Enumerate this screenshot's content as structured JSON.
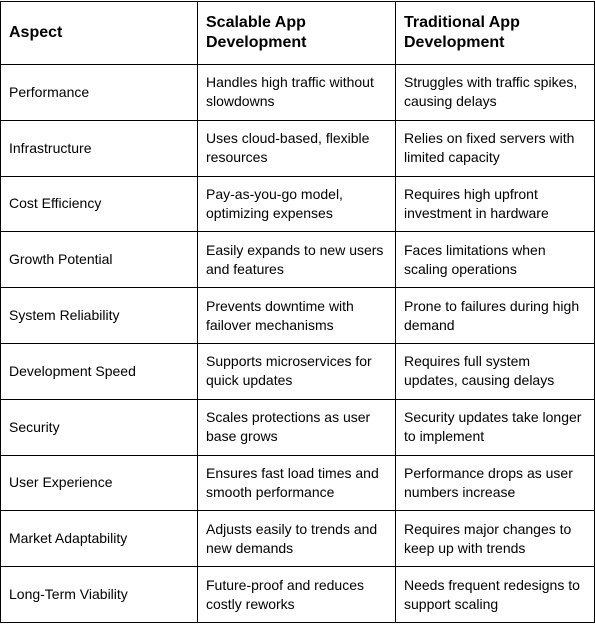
{
  "table": {
    "headers": [
      "Aspect",
      "Scalable App Development",
      "Traditional App Development"
    ],
    "rows": [
      [
        "Performance",
        "Handles high traffic without slowdowns",
        "Struggles with traffic spikes, causing delays"
      ],
      [
        "Infrastructure",
        "Uses cloud-based, flexible resources",
        "Relies on fixed servers with limited capacity"
      ],
      [
        "Cost Efficiency",
        "Pay-as-you-go model, optimizing expenses",
        "Requires high upfront investment in hardware"
      ],
      [
        "Growth Potential",
        "Easily expands to new users and features",
        "Faces limitations when scaling operations"
      ],
      [
        "System Reliability",
        "Prevents downtime with failover mechanisms",
        "Prone to failures during high demand"
      ],
      [
        "Development Speed",
        "Supports microservices for quick updates",
        "Requires full system updates, causing delays"
      ],
      [
        "Security",
        "Scales protections as user base grows",
        "Security updates take longer to implement"
      ],
      [
        "User Experience",
        "Ensures fast load times and smooth performance",
        "Performance drops as user numbers increase"
      ],
      [
        "Market Adaptability",
        "Adjusts easily to trends and new demands",
        "Requires major changes to keep up with trends"
      ],
      [
        "Long-Term Viability",
        "Future-proof and reduces costly reworks",
        "Needs frequent redesigns to support scaling"
      ]
    ]
  }
}
